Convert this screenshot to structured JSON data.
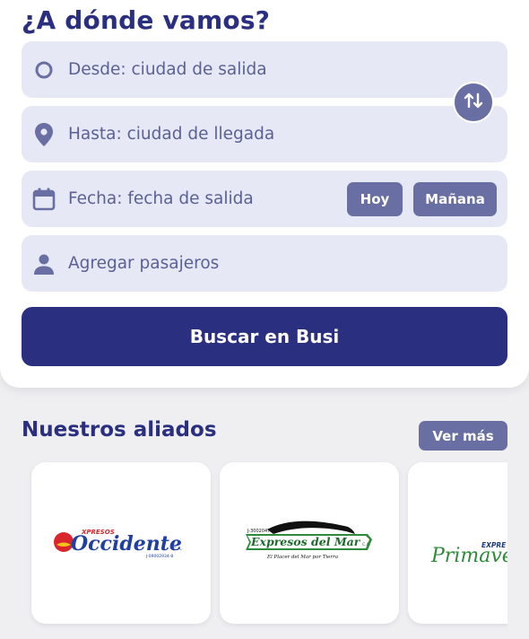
{
  "header": {
    "title": "¿A dónde vamos?"
  },
  "search_form": {
    "from": {
      "placeholder": "Desde: ciudad de salida",
      "icon": "circle-outline-icon"
    },
    "to": {
      "placeholder": "Hasta: ciudad de llegada",
      "icon": "location-pin-icon"
    },
    "swap": {
      "icon": "swap-vertical-icon"
    },
    "date": {
      "placeholder": "Fecha: fecha de salida",
      "icon": "calendar-icon",
      "quick_options": [
        "Hoy",
        "Mañana"
      ]
    },
    "passengers": {
      "placeholder": "Agregar pasajeros",
      "icon": "person-icon"
    },
    "submit_label": "Buscar en Busi"
  },
  "partners": {
    "title": "Nuestros aliados",
    "see_more_label": "Ver más",
    "items": [
      {
        "logo_text": "Occidente",
        "small_text": "XPRESOS",
        "suffix": "C.A.",
        "rif": "J-09002934-8"
      },
      {
        "logo_text": "Expresos del Mar",
        "suffix": "C.A.",
        "rif": "J-30020475-8",
        "tagline": "El Placer del Mar por Tierra"
      },
      {
        "logo_text": "Primave",
        "small_text": "EXPRE"
      }
    ]
  },
  "colors": {
    "primary": "#2b2f7f",
    "secondary": "#6a6fa3",
    "field_bg": "#e7e8f5",
    "field_text": "#5b6096",
    "page_bg": "#efeff2"
  }
}
